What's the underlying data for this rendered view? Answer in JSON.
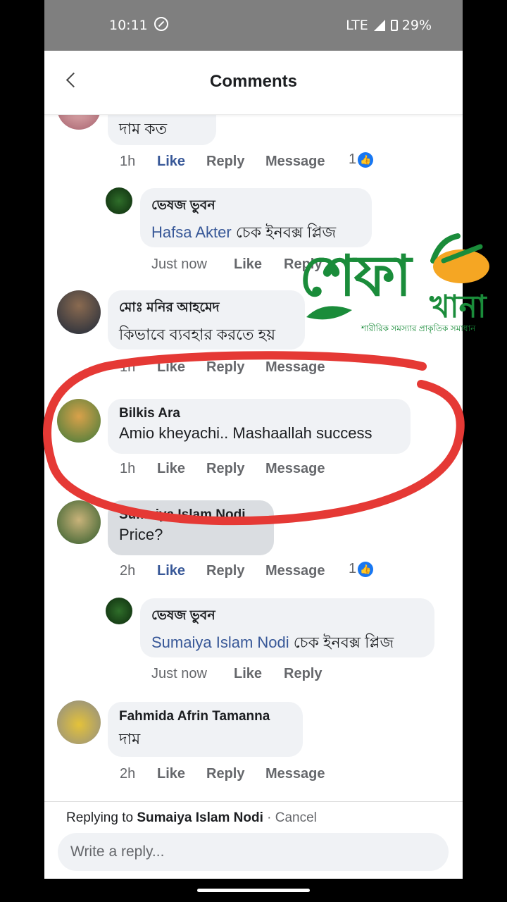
{
  "status_bar": {
    "time": "10:11",
    "network": "LTE",
    "battery": "29%"
  },
  "header": {
    "title": "Comments"
  },
  "comments": [
    {
      "id": "c0",
      "text": "দাম কত",
      "time": "1h",
      "like": "Like",
      "reply": "Reply",
      "message": "Message",
      "reaction_count": "1",
      "liked": true
    },
    {
      "id": "r0",
      "name": "ভেষজ ভুবন",
      "mention": "Hafsa Akter",
      "text": " চেক ইনবক্স প্লিজ",
      "time": "Just now",
      "like": "Like",
      "reply": "Reply"
    },
    {
      "id": "c1",
      "name": "মোঃ মনির আহমেদ",
      "text": "কিভাবে ব্যবহার করতে হয়",
      "time": "1h",
      "like": "Like",
      "reply": "Reply",
      "message": "Message"
    },
    {
      "id": "c2",
      "name": "Bilkis Ara",
      "text": "Amio kheyachi.. Mashaallah success",
      "time": "1h",
      "like": "Like",
      "reply": "Reply",
      "message": "Message"
    },
    {
      "id": "c3",
      "name": "Sumaiya Islam Nodi",
      "text": "Price?",
      "time": "2h",
      "like": "Like",
      "reply": "Reply",
      "message": "Message",
      "reaction_count": "1",
      "liked": true
    },
    {
      "id": "r1",
      "name": "ভেষজ ভুবন",
      "mention": "Sumaiya Islam Nodi",
      "text": " চেক ইনবক্স প্লিজ",
      "time": "Just now",
      "like": "Like",
      "reply": "Reply"
    },
    {
      "id": "c4",
      "name": "Fahmida Afrin Tamanna",
      "text": "দাম",
      "time": "2h",
      "like": "Like",
      "reply": "Reply",
      "message": "Message"
    }
  ],
  "reply_bar": {
    "prefix": "Replying to ",
    "target": "Sumaiya Islam Nodi",
    "separator": " · ",
    "cancel": "Cancel",
    "placeholder": "Write a reply..."
  },
  "watermark": {
    "main": "শেফা",
    "sub": "খানা",
    "tagline": "শারীরিক সমস্যার প্রাকৃতিক সমাধান",
    "colors": {
      "green": "#1a8c3a",
      "orange": "#f5a623"
    }
  },
  "colors": {
    "like_blue": "#385898",
    "badge_blue": "#1877f2",
    "annotation_red": "#e53935"
  }
}
